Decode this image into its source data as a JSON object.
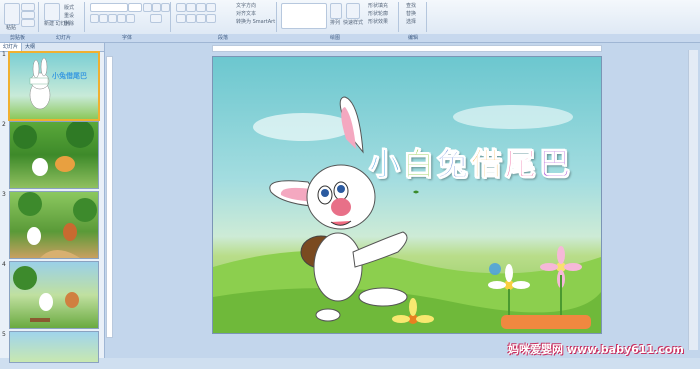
{
  "ribbon": {
    "groups": [
      "剪贴板",
      "幻灯片",
      "字体",
      "段落",
      "绘图",
      "编辑"
    ],
    "buttons": {
      "paste": "粘贴",
      "new_slide": "新建\n幻灯片",
      "layout": "版式",
      "reset": "重设",
      "delete": "删除",
      "text_direction": "文字方向",
      "align_text": "对齐文本",
      "smartart": "转换为 SmartArt",
      "arrange": "排列",
      "quick_styles": "快速样式",
      "shape_fill": "形状填充",
      "shape_outline": "形状轮廓",
      "shape_effects": "形状效果",
      "find": "查找",
      "replace": "替换",
      "select": "选择"
    }
  },
  "panel": {
    "tabs": [
      "幻灯片",
      "大纲"
    ],
    "slide_numbers": [
      "1",
      "2",
      "3",
      "4",
      "5"
    ]
  },
  "slide": {
    "title_chars": [
      {
        "char": "小",
        "color": "#3a9be0"
      },
      {
        "char": "白",
        "color": "#7cc229"
      },
      {
        "char": "兔",
        "color": "#2a58c8"
      },
      {
        "char": "借",
        "color": "#f0a020"
      },
      {
        "char": "尾",
        "color": "#e62a7a"
      },
      {
        "char": "巴",
        "color": "#a13bd0"
      }
    ],
    "thumb_title": "小兔借尾巴"
  },
  "watermark": "妈咪爱婴网 www.baby611.com"
}
